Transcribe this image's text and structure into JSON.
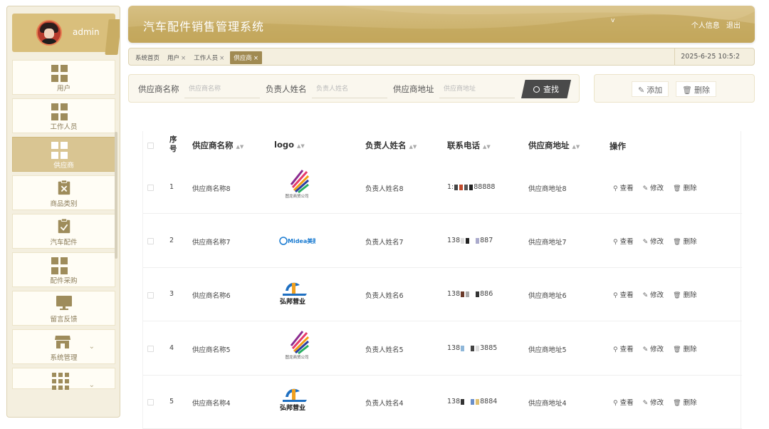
{
  "header": {
    "title": "汽车配件销售管理系统",
    "dot": "v",
    "profile_link": "个人信息",
    "logout_link": "退出"
  },
  "sidebar": {
    "user": {
      "name": "admin"
    },
    "items": [
      {
        "label": "用户",
        "icon": "grid-icon"
      },
      {
        "label": "工作人员",
        "icon": "grid-icon"
      },
      {
        "label": "供应商",
        "icon": "grid-icon",
        "active": true
      },
      {
        "label": "商品类别",
        "icon": "clipboard-x-icon"
      },
      {
        "label": "汽车配件",
        "icon": "clipboard-check-icon"
      },
      {
        "label": "配件采购",
        "icon": "grid-icon"
      },
      {
        "label": "留言反馈",
        "icon": "monitor-icon"
      },
      {
        "label": "系统管理",
        "icon": "store-icon",
        "expandable": true
      },
      {
        "label": "",
        "icon": "grid9-icon",
        "expandable": true
      }
    ]
  },
  "tabs": {
    "items": [
      {
        "label": "系统首页",
        "closable": false
      },
      {
        "label": "用户",
        "closable": true
      },
      {
        "label": "工作人员",
        "closable": true
      },
      {
        "label": "供应商",
        "closable": true,
        "active": true
      }
    ],
    "close_glyph": "×",
    "clock": "2025-6-25 10:5:2"
  },
  "search": {
    "fields": [
      {
        "label": "供应商名称",
        "placeholder": "供应商名称"
      },
      {
        "label": "负责人姓名",
        "placeholder": "负责人姓名"
      },
      {
        "label": "供应商地址",
        "placeholder": "供应商地址"
      }
    ],
    "button": "查找"
  },
  "actions": {
    "add": "添加",
    "delete": "删除"
  },
  "table": {
    "columns": [
      "序号",
      "供应商名称",
      "logo",
      "负责人姓名",
      "联系电话",
      "供应商地址",
      "操作"
    ],
    "ops": {
      "view": "查看",
      "edit": "修改",
      "delete": "删除"
    },
    "rows": [
      {
        "index": "1",
        "name": "供应商名称8",
        "logo": "wave-logo",
        "logo_text": "图龙商贸公司",
        "contact": "负责人姓名8",
        "phone_pre": "1:",
        "phone_post": "88888",
        "address": "供应商地址8"
      },
      {
        "index": "2",
        "name": "供应商名称7",
        "logo": "midea-logo",
        "logo_text": "Midea美购",
        "contact": "负责人姓名7",
        "phone_pre": "138",
        "phone_post": "887",
        "address": "供应商地址7"
      },
      {
        "index": "3",
        "name": "供应商名称6",
        "logo": "hongbang-logo",
        "logo_text": "弘邦营业",
        "contact": "负责人姓名6",
        "phone_pre": "138",
        "phone_post": "886",
        "address": "供应商地址6"
      },
      {
        "index": "4",
        "name": "供应商名称5",
        "logo": "wave-logo",
        "logo_text": "图龙商贸公司",
        "contact": "负责人姓名5",
        "phone_pre": "138",
        "phone_post": "3885",
        "address": "供应商地址5"
      },
      {
        "index": "5",
        "name": "供应商名称4",
        "logo": "hongbang-logo",
        "logo_text": "弘邦营业",
        "contact": "负责人姓名4",
        "phone_pre": "138",
        "phone_post": "8884",
        "address": "供应商地址4"
      }
    ]
  },
  "colors": {
    "accent": "#c7ac62",
    "sidebar_bg": "#f4efdf",
    "active_item": "#d9c592",
    "search_button": "#4a4a4a"
  }
}
